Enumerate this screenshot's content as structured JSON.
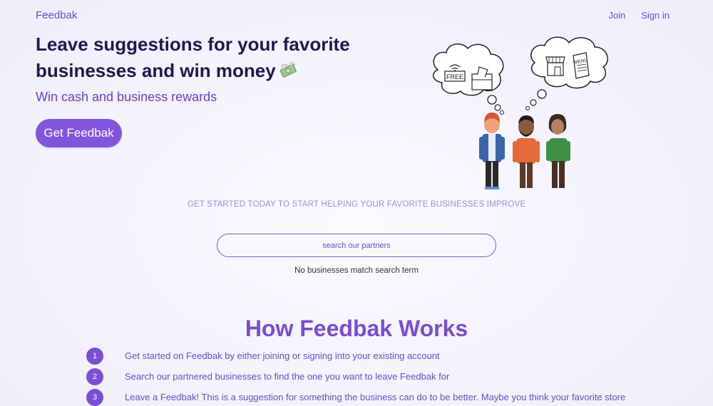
{
  "nav": {
    "logo": "Feedbak",
    "join_label": "Join",
    "signin_label": "Sign in"
  },
  "hero": {
    "title": "Leave suggestions for your favorite businesses and win money",
    "subtitle": "Win cash and business rewards",
    "cta_label": "Get Feedbak",
    "illustration": {
      "left_bubble_label": "FREE",
      "right_bubble_label": "MENU",
      "money_icon": "money-with-wings-icon"
    }
  },
  "tagline": "GET STARTED TODAY TO START HELPING YOUR FAVORITE BUSINESSES IMPROVE",
  "search": {
    "placeholder": "search our partners",
    "empty_message": "No businesses match search term"
  },
  "how_it_works": {
    "title": "How Feedbak Works",
    "steps": [
      {
        "number": "1",
        "text": "Get started on Feedbak by either joining or signing into your existing account"
      },
      {
        "number": "2",
        "text": "Search our partnered businesses to find the one you want to leave Feedbak for"
      },
      {
        "number": "3",
        "text": "Leave a Feedbak! This is a suggestion for something the business can do to be better. Maybe you think your favorite store"
      }
    ]
  },
  "colors": {
    "accent": "#7a4bd8",
    "title": "#21174f",
    "button": "#8154df"
  }
}
